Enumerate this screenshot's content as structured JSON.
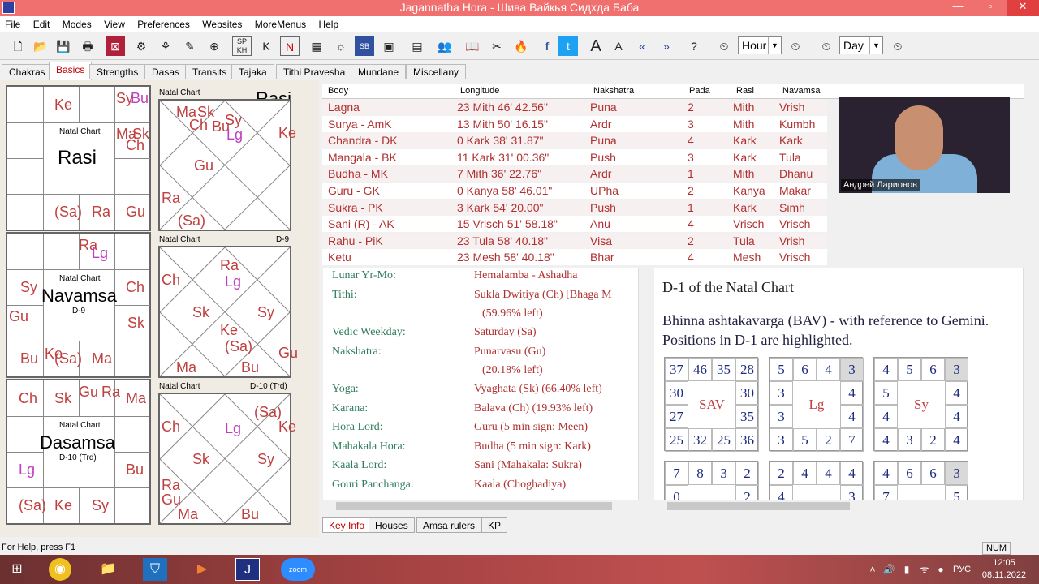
{
  "window": {
    "title": "Jagannatha Hora - Шива Вайкья Сидхда Баба"
  },
  "menu": [
    "File",
    "Edit",
    "Modes",
    "View",
    "Preferences",
    "Websites",
    "MoreMenus",
    "Help"
  ],
  "toolbar": {
    "hour_combo": "Hour",
    "day_combo": "Day"
  },
  "tabs": [
    "Chakras",
    "Basics",
    "Strengths",
    "Dasas",
    "Transits",
    "Tajaka",
    "Tithi Pravesha",
    "Mundane",
    "Miscellany"
  ],
  "active_tab": "Basics",
  "charts": {
    "rasi_name": "Rasi",
    "navamsa_name": "Navamsa",
    "navamsa_sub": "D-9",
    "dasamsa_name": "Dasamsa",
    "dasamsa_sub": "D-10 (Trd)",
    "natal_label": "Natal Chart",
    "d9_label": "D-9",
    "d10_label": "D-10 (Trd)",
    "rasi_label_right": "Rasi"
  },
  "table": {
    "headers": [
      "Body",
      "Longitude",
      "Nakshatra",
      "Pada",
      "Rasi",
      "Navamsa"
    ],
    "rows": [
      [
        "Lagna",
        "23 Mith 46' 42.56\"",
        "Puna",
        "2",
        "Mith",
        "Vrish"
      ],
      [
        "Surya - AmK",
        "13 Mith 50' 16.15\"",
        "Ardr",
        "3",
        "Mith",
        "Kumbh"
      ],
      [
        "Chandra - DK",
        "0 Kark 38' 31.87\"",
        "Puna",
        "4",
        "Kark",
        "Kark"
      ],
      [
        "Mangala - BK",
        "11 Kark 31' 00.36\"",
        "Push",
        "3",
        "Kark",
        "Tula"
      ],
      [
        "Budha - MK",
        "7 Mith 36' 22.76\"",
        "Ardr",
        "1",
        "Mith",
        "Dhanu"
      ],
      [
        "Guru - GK",
        "0 Kanya 58' 46.01\"",
        "UPha",
        "2",
        "Kanya",
        "Makar"
      ],
      [
        "Sukra - PK",
        "3 Kark 54' 20.00\"",
        "Push",
        "1",
        "Kark",
        "Simh"
      ],
      [
        "Sani (R) - AK",
        "15 Vrisch 51' 58.18\"",
        "Anu",
        "4",
        "Vrisch",
        "Vrisch"
      ],
      [
        "Rahu - PiK",
        "23 Tula 58' 40.18\"",
        "Visa",
        "2",
        "Tula",
        "Vrish"
      ],
      [
        "Ketu",
        "23 Mesh 58' 40.18\"",
        "Bhar",
        "4",
        "Mesh",
        "Vrisch"
      ]
    ]
  },
  "video": {
    "name": "Андрей Ларионов"
  },
  "keyinfo": [
    {
      "label": "Lunar Yr-Mo:",
      "value": "Hemalamba - Ashadha"
    },
    {
      "label": "Tithi:",
      "value": "Sukla Dwitiya (Ch) [Bhaga M"
    },
    {
      "label": "",
      "value": "(59.96% left)"
    },
    {
      "label": "Vedic Weekday:",
      "value": "Saturday (Sa)"
    },
    {
      "label": "Nakshatra:",
      "value": "Punarvasu (Gu)"
    },
    {
      "label": "",
      "value": "(20.18% left)"
    },
    {
      "label": "Yoga:",
      "value": "Vyaghata (Sk) (66.40% left)"
    },
    {
      "label": "Karana:",
      "value": "Balava (Ch) (19.93% left)"
    },
    {
      "label": "Hora Lord:",
      "value": "Guru (5 min sign: Meen)"
    },
    {
      "label": "Mahakala Hora:",
      "value": "Budha (5 min sign: Kark)"
    },
    {
      "label": "Kaala Lord:",
      "value": "Sani (Mahakala: Sukra)"
    },
    {
      "label": "Gouri Panchanga:",
      "value": "Kaala (Choghadiya)"
    }
  ],
  "bav": {
    "title": "D-1 of the Natal Chart",
    "description": "Bhinna ashtakavarga (BAV) - with reference to Gemini. Positions in D-1 are highlighted.",
    "grids": [
      {
        "center": "SAV",
        "top": [
          "37",
          "46",
          "35",
          "28"
        ],
        "right": [
          "30",
          "35"
        ],
        "left": [
          "30",
          "27"
        ],
        "bottom": [
          "25",
          "32",
          "25",
          "36"
        ],
        "hl": []
      },
      {
        "center": "Lg",
        "top": [
          "5",
          "6",
          "4",
          "3"
        ],
        "right": [
          "4",
          "4"
        ],
        "left": [
          "3",
          "3"
        ],
        "bottom": [
          "3",
          "5",
          "2",
          "7"
        ],
        "hl": [
          3
        ]
      },
      {
        "center": "Sy",
        "top": [
          "4",
          "5",
          "6",
          "3"
        ],
        "right": [
          "4",
          "4"
        ],
        "left": [
          "5",
          "4"
        ],
        "bottom": [
          "4",
          "3",
          "2",
          "4"
        ],
        "hl": [
          3
        ]
      },
      {
        "center": "",
        "top": [
          "7",
          "8",
          "3",
          "2"
        ],
        "right": [
          "2",
          ""
        ],
        "left": [
          "0",
          ""
        ],
        "bottom": [
          "",
          "",
          "",
          ""
        ],
        "hl": []
      },
      {
        "center": "",
        "top": [
          "2",
          "4",
          "4",
          "4"
        ],
        "right": [
          "3",
          ""
        ],
        "left": [
          "4",
          ""
        ],
        "bottom": [
          "",
          "",
          "",
          ""
        ],
        "hl": []
      },
      {
        "center": "",
        "top": [
          "4",
          "6",
          "6",
          "3"
        ],
        "right": [
          "5",
          ""
        ],
        "left": [
          "7",
          ""
        ],
        "bottom": [
          "",
          "",
          "",
          ""
        ],
        "hl": [
          3
        ]
      }
    ]
  },
  "bottom_tabs": [
    "Key Info",
    "Houses",
    "Amsa rulers",
    "KP"
  ],
  "status": {
    "left": "For Help, press F1",
    "num": "NUM"
  },
  "taskbar": {
    "lang": "РУС",
    "time": "12:05",
    "date": "08.11.2022"
  }
}
